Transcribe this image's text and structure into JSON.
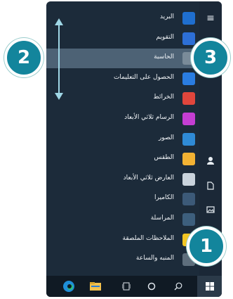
{
  "start_menu": {
    "apps": [
      {
        "label": "البريد",
        "icon": "mail-icon",
        "color": "#1f6fcf"
      },
      {
        "label": "التقويم",
        "icon": "calendar-icon",
        "color": "#2d6fd6"
      },
      {
        "label": "الحاسبة",
        "icon": "calculator-icon",
        "color": "#7a8b99",
        "highlighted": true
      },
      {
        "label": "الحصول على التعليمات",
        "icon": "help-icon",
        "color": "#2a7de1"
      },
      {
        "label": "الخرائط",
        "icon": "maps-icon",
        "color": "#e0463c"
      },
      {
        "label": "الرسام ثلاثي الأبعاد",
        "icon": "paint3d-icon",
        "color": "#c43ed2"
      },
      {
        "label": "الصور",
        "icon": "photos-icon",
        "color": "#2f8bd6"
      },
      {
        "label": "الطقس",
        "icon": "weather-icon",
        "color": "#f2b233"
      },
      {
        "label": "العارض ثلاثي الأبعاد",
        "icon": "cube-icon",
        "color": "#c9d3dc"
      },
      {
        "label": "الكاميرا",
        "icon": "camera-icon",
        "color": "#3c5a78"
      },
      {
        "label": "المراسلة",
        "icon": "message-icon",
        "color": "#3d5f7d"
      },
      {
        "label": "الملاحظات الملصقة",
        "icon": "sticky-note-icon",
        "color": "#f3c623"
      },
      {
        "label": "المنبه والساعة",
        "icon": "clock-icon",
        "color": "#5e6e7c"
      }
    ]
  },
  "badges": {
    "one": "1",
    "two": "2",
    "three": "3"
  },
  "colors": {
    "menu_bg": "#1c2b3a",
    "highlight": "#4d6275",
    "badge": "#13859c",
    "taskbar": "#101a24"
  }
}
